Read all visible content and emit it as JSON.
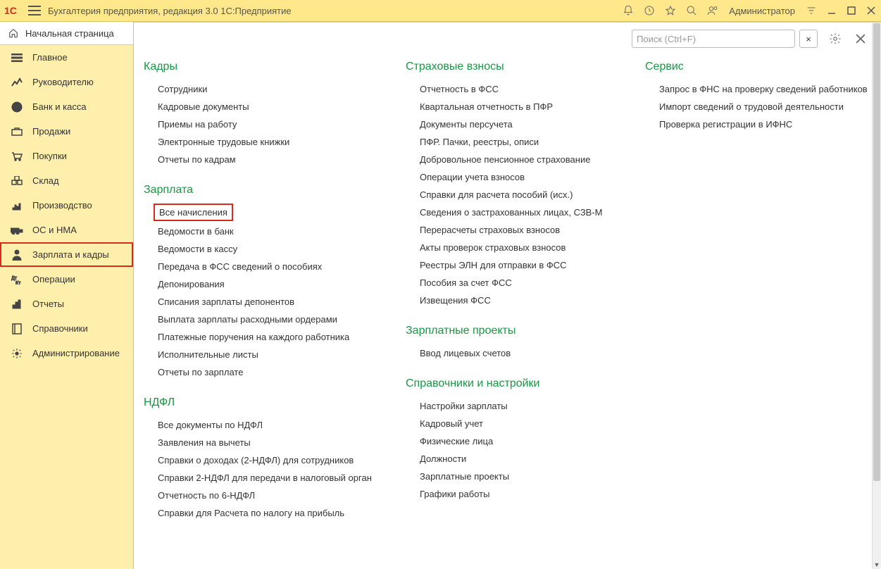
{
  "app_title": "Бухгалтерия предприятия, редакция 3.0 1С:Предприятие",
  "user": "Администратор",
  "start_page": "Начальная страница",
  "search": {
    "placeholder": "Поиск (Ctrl+F)",
    "clear": "×"
  },
  "sidebar": [
    {
      "id": "main",
      "label": "Главное"
    },
    {
      "id": "manager",
      "label": "Руководителю"
    },
    {
      "id": "bank",
      "label": "Банк и касса"
    },
    {
      "id": "sales",
      "label": "Продажи"
    },
    {
      "id": "purchases",
      "label": "Покупки"
    },
    {
      "id": "warehouse",
      "label": "Склад"
    },
    {
      "id": "manufacturing",
      "label": "Производство"
    },
    {
      "id": "assets",
      "label": "ОС и НМА"
    },
    {
      "id": "hr",
      "label": "Зарплата и кадры",
      "active": true
    },
    {
      "id": "operations",
      "label": "Операции"
    },
    {
      "id": "reports",
      "label": "Отчеты"
    },
    {
      "id": "catalogs",
      "label": "Справочники"
    },
    {
      "id": "admin",
      "label": "Администрирование"
    }
  ],
  "col1": [
    {
      "title": "Кадры",
      "first": true,
      "items": [
        "Сотрудники",
        "Кадровые документы",
        "Приемы на работу",
        "Электронные трудовые книжки",
        "Отчеты по кадрам"
      ]
    },
    {
      "title": "Зарплата",
      "items": [
        {
          "label": "Все начисления",
          "highlight": true
        },
        "Ведомости в банк",
        "Ведомости в кассу",
        "Передача в ФСС сведений о пособиях",
        "Депонирования",
        "Списания зарплаты депонентов",
        "Выплата зарплаты расходными ордерами",
        "Платежные поручения на каждого работника",
        "Исполнительные листы",
        "Отчеты по зарплате"
      ]
    },
    {
      "title": "НДФЛ",
      "items": [
        "Все документы по НДФЛ",
        "Заявления на вычеты",
        "Справки о доходах (2-НДФЛ) для сотрудников",
        "Справки 2-НДФЛ для передачи в налоговый орган",
        "Отчетность по 6-НДФЛ",
        "Справки для Расчета по налогу на прибыль"
      ]
    }
  ],
  "col2": [
    {
      "title": "Страховые взносы",
      "first": true,
      "items": [
        "Отчетность в ФСС",
        "Квартальная отчетность в ПФР",
        "Документы персучета",
        "ПФР. Пачки, реестры, описи",
        "Добровольное пенсионное страхование",
        "Операции учета взносов",
        "Справки для расчета пособий (исх.)",
        "Сведения о застрахованных лицах, СЗВ-М",
        "Перерасчеты страховых взносов",
        "Акты проверок страховых взносов",
        "Реестры ЭЛН для отправки в ФСС",
        "Пособия за счет ФСС",
        "Извещения ФСС"
      ]
    },
    {
      "title": "Зарплатные проекты",
      "items": [
        "Ввод лицевых счетов"
      ]
    },
    {
      "title": "Справочники и настройки",
      "items": [
        "Настройки зарплаты",
        "Кадровый учет",
        "Физические лица",
        "Должности",
        "Зарплатные проекты",
        "Графики работы"
      ]
    }
  ],
  "col3": [
    {
      "title": "Сервис",
      "first": true,
      "items": [
        "Запрос в ФНС на проверку сведений работников",
        "Импорт сведений о трудовой деятельности",
        "Проверка регистрации в ИФНС"
      ]
    }
  ]
}
